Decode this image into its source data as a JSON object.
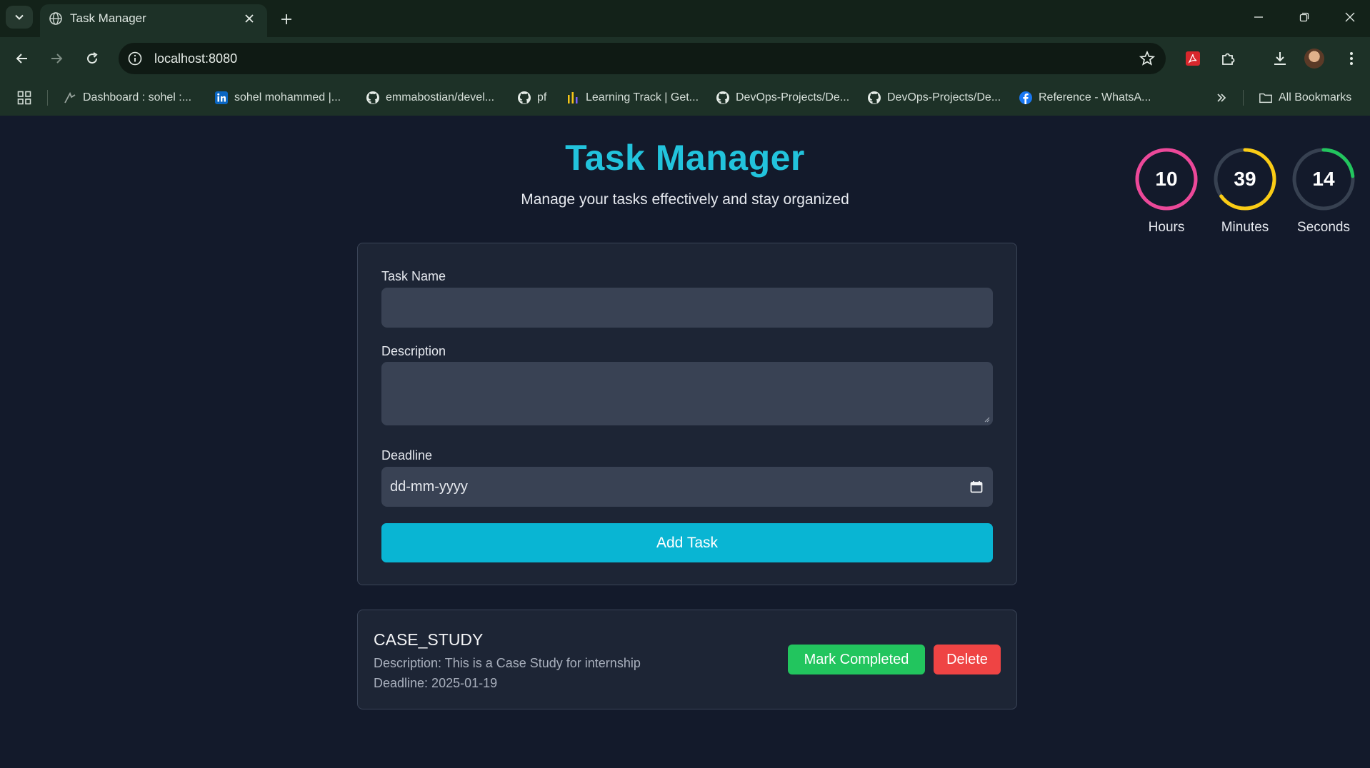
{
  "browser": {
    "tab": {
      "title": "Task Manager",
      "favicon": "globe-icon"
    },
    "url": "localhost:8080",
    "bookmarks": [
      {
        "label": "Dashboard : sohel :...",
        "icon": "dashboard-favicon"
      },
      {
        "label": "sohel mohammed |...",
        "icon": "linkedin-icon"
      },
      {
        "label": "emmabostian/devel...",
        "icon": "github-icon"
      },
      {
        "label": "pf",
        "icon": "github-icon"
      },
      {
        "label": "Learning Track | Get...",
        "icon": "learning-track-icon"
      },
      {
        "label": "DevOps-Projects/De...",
        "icon": "github-icon"
      },
      {
        "label": "DevOps-Projects/De...",
        "icon": "github-icon"
      },
      {
        "label": "Reference - WhatsA...",
        "icon": "facebook-icon"
      }
    ],
    "all_bookmarks": "All Bookmarks"
  },
  "page": {
    "title": "Task Manager",
    "subtitle": "Manage your tasks effectively and stay organized"
  },
  "clock": {
    "hours": {
      "value": "10",
      "label": "Hours",
      "color": "#ec4899",
      "fraction": 1.0
    },
    "minutes": {
      "value": "39",
      "label": "Minutes",
      "color": "#facc15",
      "fraction": 0.65
    },
    "seconds": {
      "value": "14",
      "label": "Seconds",
      "color": "#22c55e",
      "fraction": 0.233
    }
  },
  "form": {
    "task_name_label": "Task Name",
    "task_name_value": "",
    "description_label": "Description",
    "description_value": "",
    "deadline_label": "Deadline",
    "deadline_placeholder": "dd-mm-yyyy",
    "add_button": "Add Task"
  },
  "tasks": [
    {
      "name": "CASE_STUDY",
      "description": "Description: This is a Case Study for internship",
      "deadline": "Deadline: 2025-01-19",
      "complete_button": "Mark Completed",
      "delete_button": "Delete"
    }
  ],
  "colors": {
    "accent": "#22c3dc",
    "button": "#09b5d3",
    "complete": "#22c55e",
    "delete": "#ef4444",
    "background": "#131a2b"
  }
}
